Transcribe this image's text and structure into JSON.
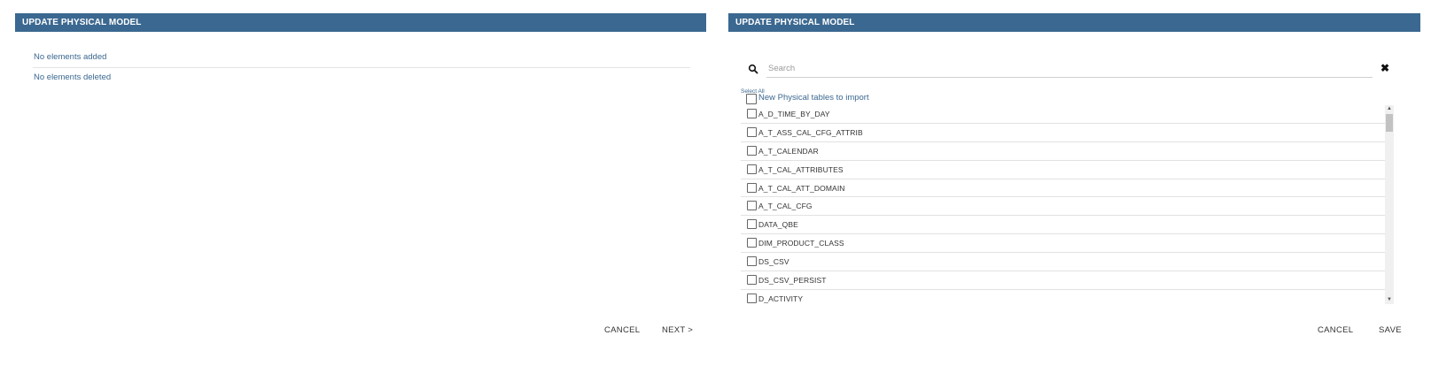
{
  "left_dialog": {
    "title": "UPDATE PHYSICAL MODEL",
    "summary": [
      "No elements added",
      "No elements deleted"
    ],
    "cancel_label": "CANCEL",
    "next_label": "NEXT >"
  },
  "right_dialog": {
    "title": "UPDATE PHYSICAL MODEL",
    "search": {
      "placeholder": "Search",
      "value": "",
      "search_icon": "search-icon",
      "clear_icon": "close-icon"
    },
    "select_all_label": "Select All",
    "select_all_text": "New Physical tables to import",
    "tables": [
      "A_D_TIME_BY_DAY",
      "A_T_ASS_CAL_CFG_ATTRIB",
      "A_T_CALENDAR",
      "A_T_CAL_ATTRIBUTES",
      "A_T_CAL_ATT_DOMAIN",
      "A_T_CAL_CFG",
      "DATA_QBE",
      "DIM_PRODUCT_CLASS",
      "DS_CSV",
      "DS_CSV_PERSIST",
      "D_ACTIVITY"
    ],
    "cancel_label": "CANCEL",
    "save_label": "SAVE"
  },
  "colors": {
    "header_bg": "#3b6890",
    "accent_text": "#3b6890"
  }
}
